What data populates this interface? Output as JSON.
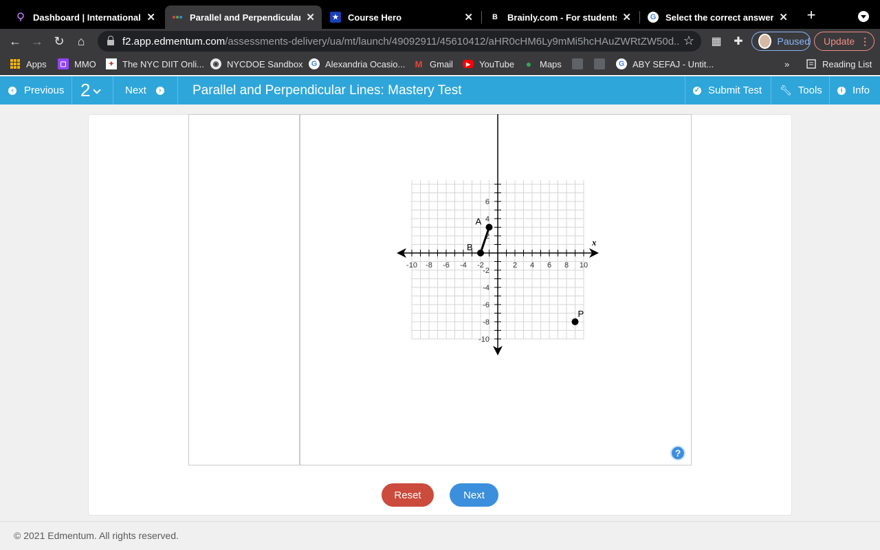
{
  "browser": {
    "tabs": [
      {
        "title": "Dashboard | International Virt",
        "icon": "bulb-icon"
      },
      {
        "title": "Parallel and Perpendicular Lin",
        "icon": "edmentum-icon"
      },
      {
        "title": "Course Hero",
        "icon": "star-icon"
      },
      {
        "title": "Brainly.com - For students. B",
        "icon": "brainly-icon"
      },
      {
        "title": "Select the correct answer. Gi",
        "icon": "google-icon"
      }
    ],
    "url_domain": "f2.app.edmentum.com",
    "url_path": "/assessments-delivery/ua/mt/launch/49092911/45610412/aHR0cHM6Ly9mMi5hcHAuZWRtZW50d...",
    "profile_status": "Paused",
    "update_label": "Update",
    "bookmarks": [
      "Apps",
      "MMO",
      "The NYC DIIT Onli...",
      "NYCDOE Sandbox",
      "Alexandria Ocasio...",
      "Gmail",
      "YouTube",
      "Maps",
      "ABY SEFAJ - Untit..."
    ],
    "more_bookmarks": "»",
    "reading_list": "Reading List"
  },
  "app": {
    "previous_label": "Previous",
    "question_number": "2",
    "next_label": "Next",
    "title": "Parallel and Perpendicular Lines: Mastery Test",
    "submit_label": "Submit Test",
    "tools_label": "Tools",
    "info_label": "Info",
    "accent_color": "#2fa6da"
  },
  "chart_data": {
    "type": "scatter",
    "xlabel": "x",
    "xlim": [
      -10,
      10
    ],
    "ylim": [
      -10,
      8
    ],
    "grid": true,
    "x_ticks": [
      -10,
      -8,
      -6,
      -4,
      -2,
      2,
      4,
      6,
      8,
      10
    ],
    "y_ticks": [
      6,
      4,
      2,
      -2,
      -4,
      -6,
      -8,
      -10
    ],
    "points": [
      {
        "label": "A",
        "x": -1,
        "y": 3
      },
      {
        "label": "B",
        "x": -2,
        "y": 0
      },
      {
        "label": "P",
        "x": 9,
        "y": -8
      }
    ],
    "segments": [
      {
        "from": "A",
        "to": "B"
      }
    ]
  },
  "help_label": "?",
  "reset_label": "Reset",
  "next_button_label": "Next",
  "footer": "© 2021 Edmentum. All rights reserved."
}
